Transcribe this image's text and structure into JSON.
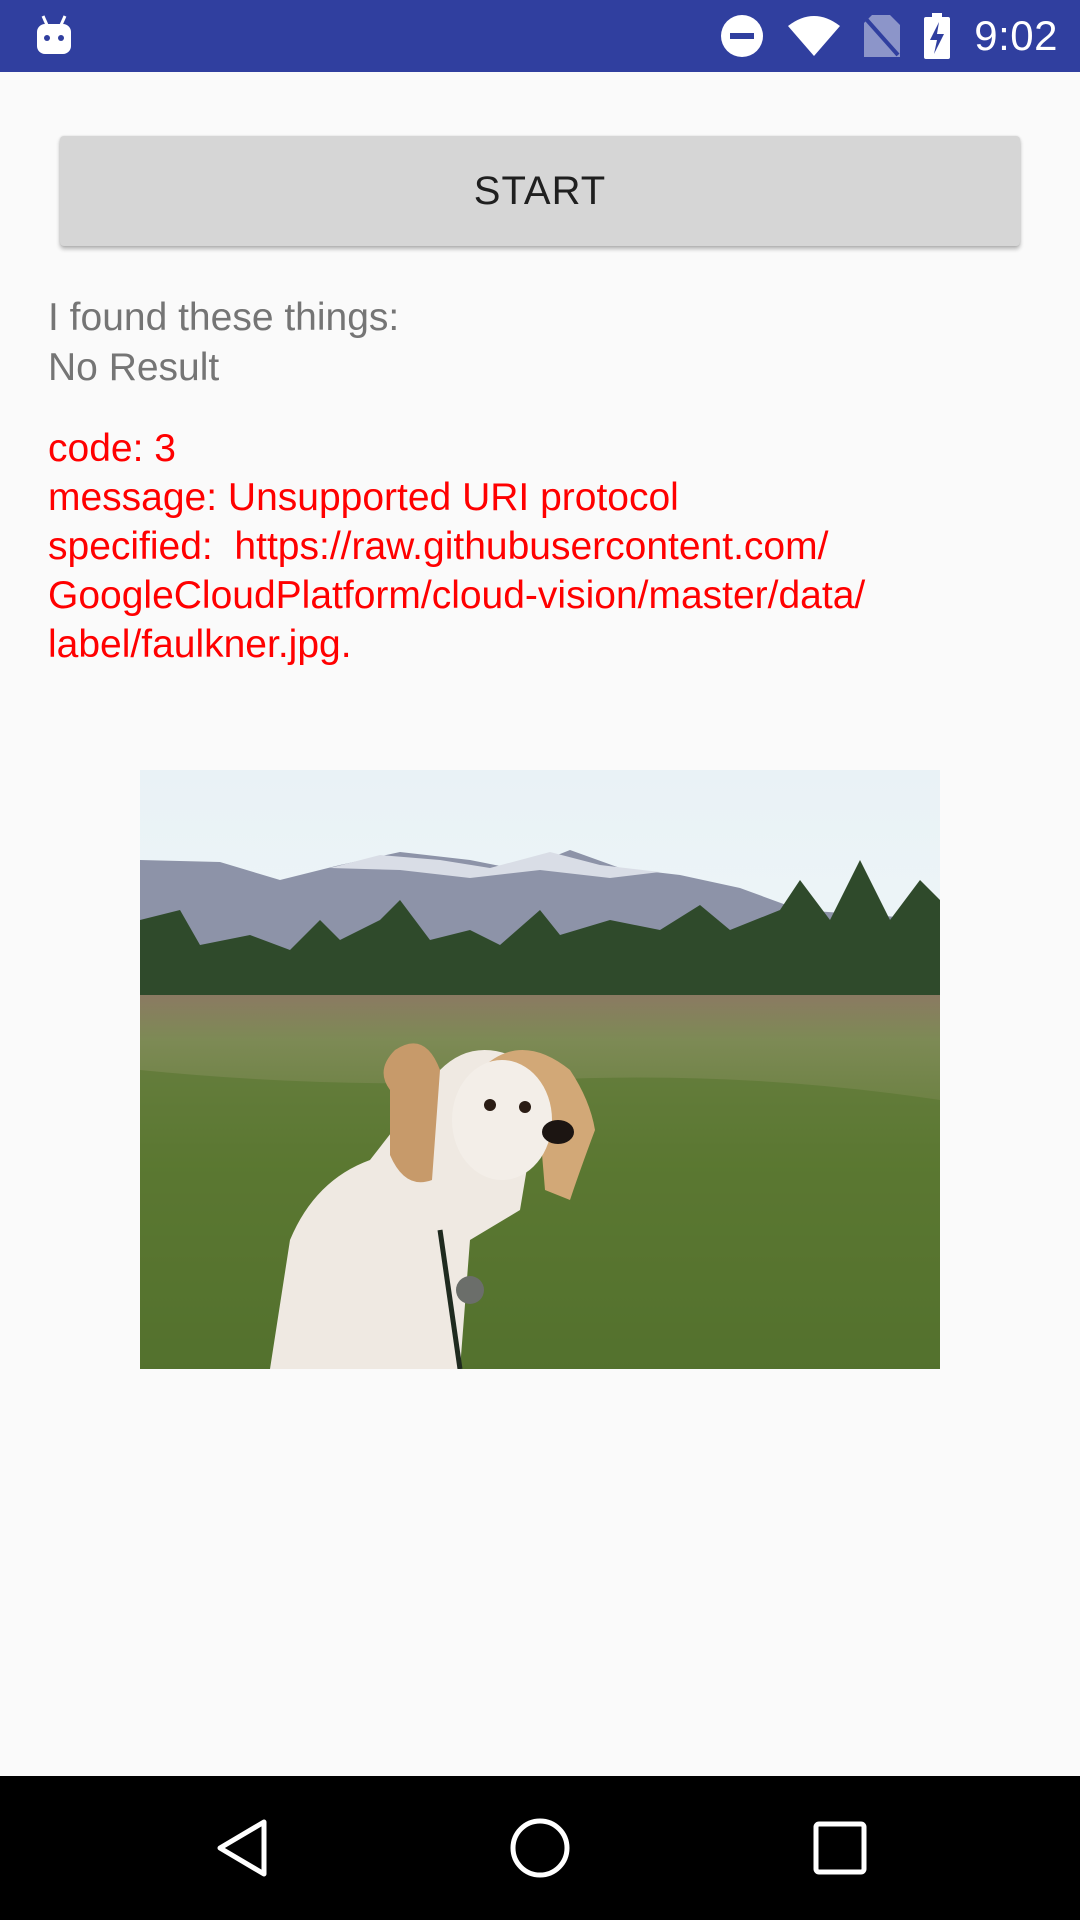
{
  "status_bar": {
    "time": "9:02",
    "icons": [
      "app-notification-icon",
      "do-not-disturb-icon",
      "wifi-icon",
      "no-sim-icon",
      "battery-charging-icon"
    ],
    "background": "#303f9f"
  },
  "main": {
    "start_button_label": "START",
    "result_heading": "I found these things:",
    "result_value": "No Result",
    "error_lines": [
      "code: 3",
      "message: Unsupported URI protocol",
      "specified:  https://raw.githubusercontent.com/",
      "GoogleCloudPlatform/cloud-vision/master/data/",
      "label/faulkner.jpg."
    ],
    "error_color": "#ff0000",
    "image_subject": "dog-in-meadow-photo"
  },
  "nav_bar": {
    "buttons": [
      "back-icon",
      "home-icon",
      "recents-icon"
    ]
  }
}
